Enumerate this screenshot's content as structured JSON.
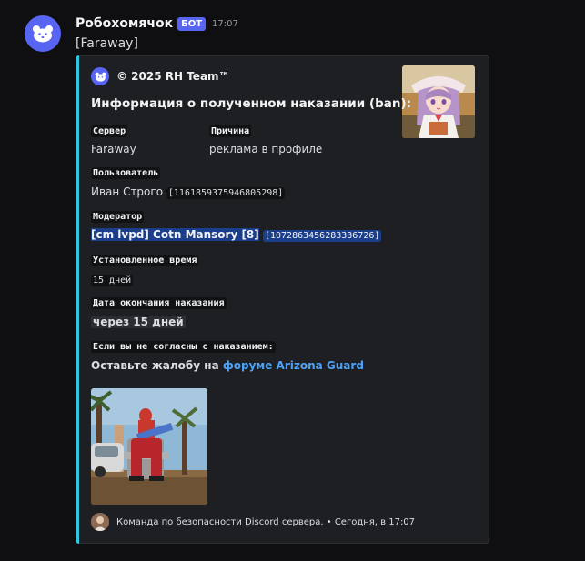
{
  "message": {
    "username": "Робохомячок",
    "bot_tag": "БОТ",
    "time": "17:07",
    "content": "[Faraway]"
  },
  "embed": {
    "accent_color": "#2fc5de",
    "author": "© 2025 RH Team™",
    "title": "Информация о полученном наказании (ban):",
    "fields": {
      "server_name": "Сервер",
      "server_value": "Faraway",
      "reason_name": "Причина",
      "reason_value": "реклама в профиле",
      "user_name": "Пользователь",
      "user_value": "Иван Строго",
      "user_id": "[1161859375946805298]",
      "moderator_name": "Модератор",
      "moderator_value": "[cm lvpd] Cotn Mansory [8]",
      "moderator_id": "[1072863456283336726]",
      "duration_name": "Установленное время",
      "duration_value": "15 дней",
      "end_name": "Дата окончания наказания",
      "end_value": "через 15 дней",
      "disagree_name": "Если вы не согласны с наказанием:",
      "disagree_prefix": "Оставьте жалобу на",
      "disagree_link": "форуме Arizona Guard"
    },
    "footer": {
      "text": "Команда по безопасности Discord сервера.",
      "separator": "•",
      "time": "Сегодня, в 17:07"
    }
  }
}
